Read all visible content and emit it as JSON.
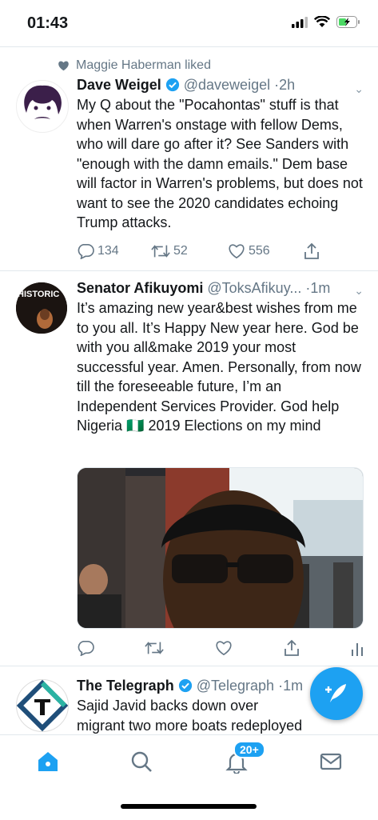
{
  "status": {
    "time": "01:43"
  },
  "tweets": [
    {
      "social_context": "Maggie Haberman liked",
      "name": "Dave Weigel",
      "handle": "@daveweigel",
      "dot": "·",
      "age": "2h",
      "verified": true,
      "text": "My Q about the \"Pocahontas\" stuff is that when Warren's onstage with fellow Dems, who will dare go after it? See Sanders with \"enough with the damn emails.\" Dem base will factor in Warren's problems, but does not want to see the 2020 candidates echoing Trump attacks.",
      "replies": "134",
      "retweets": "52",
      "likes": "556"
    },
    {
      "name": "Senator Afikuyomi",
      "handle": "@ToksAfikuy...",
      "dot": "·",
      "age": "1m",
      "avatar_text": "HISTORIC",
      "text": "It’s amazing new year&best wishes from me to you all. It’s Happy New year here. God be with you all&make 2019 your most successful year. Amen. Personally, from now till the foreseeable future, I’m  an Independent Services Provider. God help Nigeria 🇳🇬 2019 Elections on my mind"
    },
    {
      "name": "The Telegraph",
      "handle": "@Telegraph",
      "dot": "·",
      "age": "1m",
      "verified": true,
      "text": "Sajid Javid backs down over migrant two more boats redeployed to the"
    }
  ],
  "tabbar": {
    "notifications_badge": "20+"
  },
  "colors": {
    "accent": "#1da1f2",
    "muted": "#657786"
  }
}
